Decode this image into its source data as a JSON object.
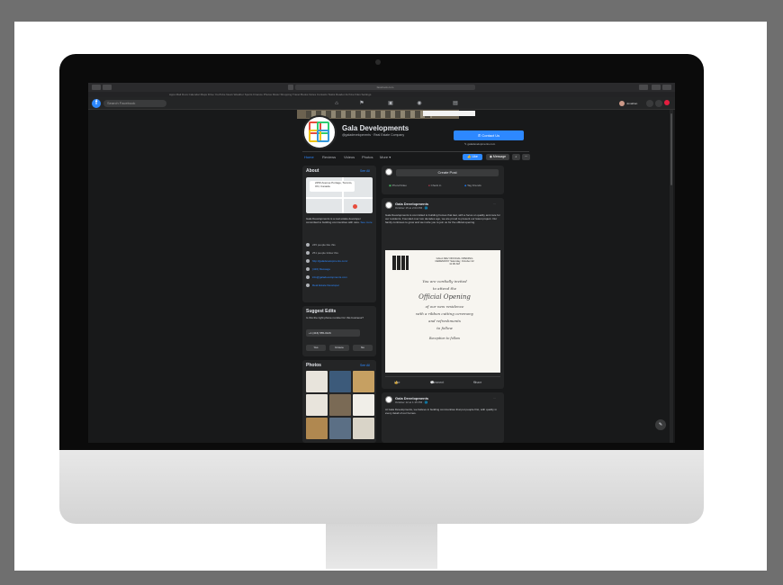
{
  "browser": {
    "url": "facebook.com",
    "bookmarks": "Apps  Mail  Docs  Calendar  Maps  Drive  YouTube  News  Weather  Sports  Finance  Photos  Music  Shopping  Travel  Books  Notes  Contacts  Tasks  Reader  Archive  Files  Settings"
  },
  "fb": {
    "logo": "f",
    "search_placeholder": "Search Facebook",
    "profile_name": "Jonathan"
  },
  "page": {
    "name": "Gala Developments",
    "subtitle": "@galadevelopments · Real Estate Company",
    "contact_button": "Contact Us",
    "website": "galadevelopments.com",
    "tabs": [
      "Home",
      "Reviews",
      "Videos",
      "Photos",
      "More ▾"
    ],
    "like_button": "Like",
    "message_button": "Message"
  },
  "about": {
    "title": "About",
    "see_all": "See All",
    "map_address": "2250 Avenue Portage, Toronto, ON, Canada",
    "description": "Gala Developments is a real estate developer committed to building communities with care.",
    "see_more": "See more",
    "rows": [
      "245 people like this",
      "251 people follow this",
      "http://galadevelopments.com/",
      "(416) Message",
      "info@galadevelopments.com",
      "Real Estate Developer"
    ]
  },
  "suggest": {
    "title": "Suggest Edits",
    "question": "Is this the right phone number for this business?",
    "phone": "+1 (416) 555-0126",
    "buttons": [
      "Yes",
      "Unsure",
      "No"
    ]
  },
  "photos": {
    "title": "Photos",
    "see_all": "See All"
  },
  "composer": {
    "create_post": "Create Post",
    "actions": [
      "Photo/Video",
      "Check in",
      "Tag Friends"
    ]
  },
  "posts": [
    {
      "name": "Gala Developments",
      "meta": "October 15 at 2:04 PM · 🌐",
      "text": "Gala Developments is committed to building homes that last, with a focus on quality and care for our residents. Founded over two decades ago, we are proud to present our latest project. Our family continues to grow and we invite you to join us for the official opening.",
      "invite": {
        "header": "GALA DEV\nOFFICIAL OPENING CEREMONY\nSaturday, October 22\n11:00 AM",
        "lines": [
          "You are cordially invited",
          "to attend the",
          "Official Opening",
          "of our new residence",
          "with a ribbon cutting ceremony",
          "and refreshments",
          "to follow",
          "Reception to follow"
        ]
      },
      "actions": [
        "Like",
        "Comment",
        "Share"
      ]
    },
    {
      "name": "Gala Developments",
      "meta": "October 12 at 1:15 PM · 🌐",
      "text": "At Gala Developments, we believe in building communities that put people first, with quality in every detail of our homes."
    }
  ]
}
